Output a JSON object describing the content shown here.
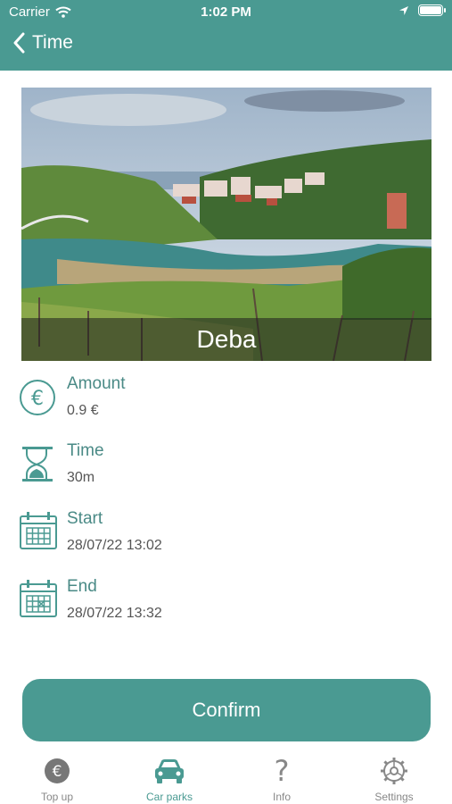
{
  "status_bar": {
    "carrier": "Carrier",
    "time": "1:02 PM"
  },
  "header": {
    "back_icon": "chevron-left-icon",
    "title": "Time"
  },
  "photo": {
    "caption": "Deba"
  },
  "details": [
    {
      "icon": "euro-icon",
      "label": "Amount",
      "value": "0.9 €"
    },
    {
      "icon": "hourglass-icon",
      "label": "Time",
      "value": "30m"
    },
    {
      "icon": "calendar-icon",
      "label": "Start",
      "value": "28/07/22 13:02"
    },
    {
      "icon": "calendar-end-icon",
      "label": "End",
      "value": "28/07/22 13:32"
    }
  ],
  "confirm_label": "Confirm",
  "tabs": [
    {
      "icon": "euro-coin-icon",
      "label": "Top up",
      "active": false
    },
    {
      "icon": "car-icon",
      "label": "Car parks",
      "active": true
    },
    {
      "icon": "question-icon",
      "label": "Info",
      "active": false
    },
    {
      "icon": "gear-icon",
      "label": "Settings",
      "active": false
    }
  ],
  "colors": {
    "primary": "#4a9a92",
    "label": "#4a8a86",
    "value": "#555555",
    "tab_inactive": "#888888"
  }
}
